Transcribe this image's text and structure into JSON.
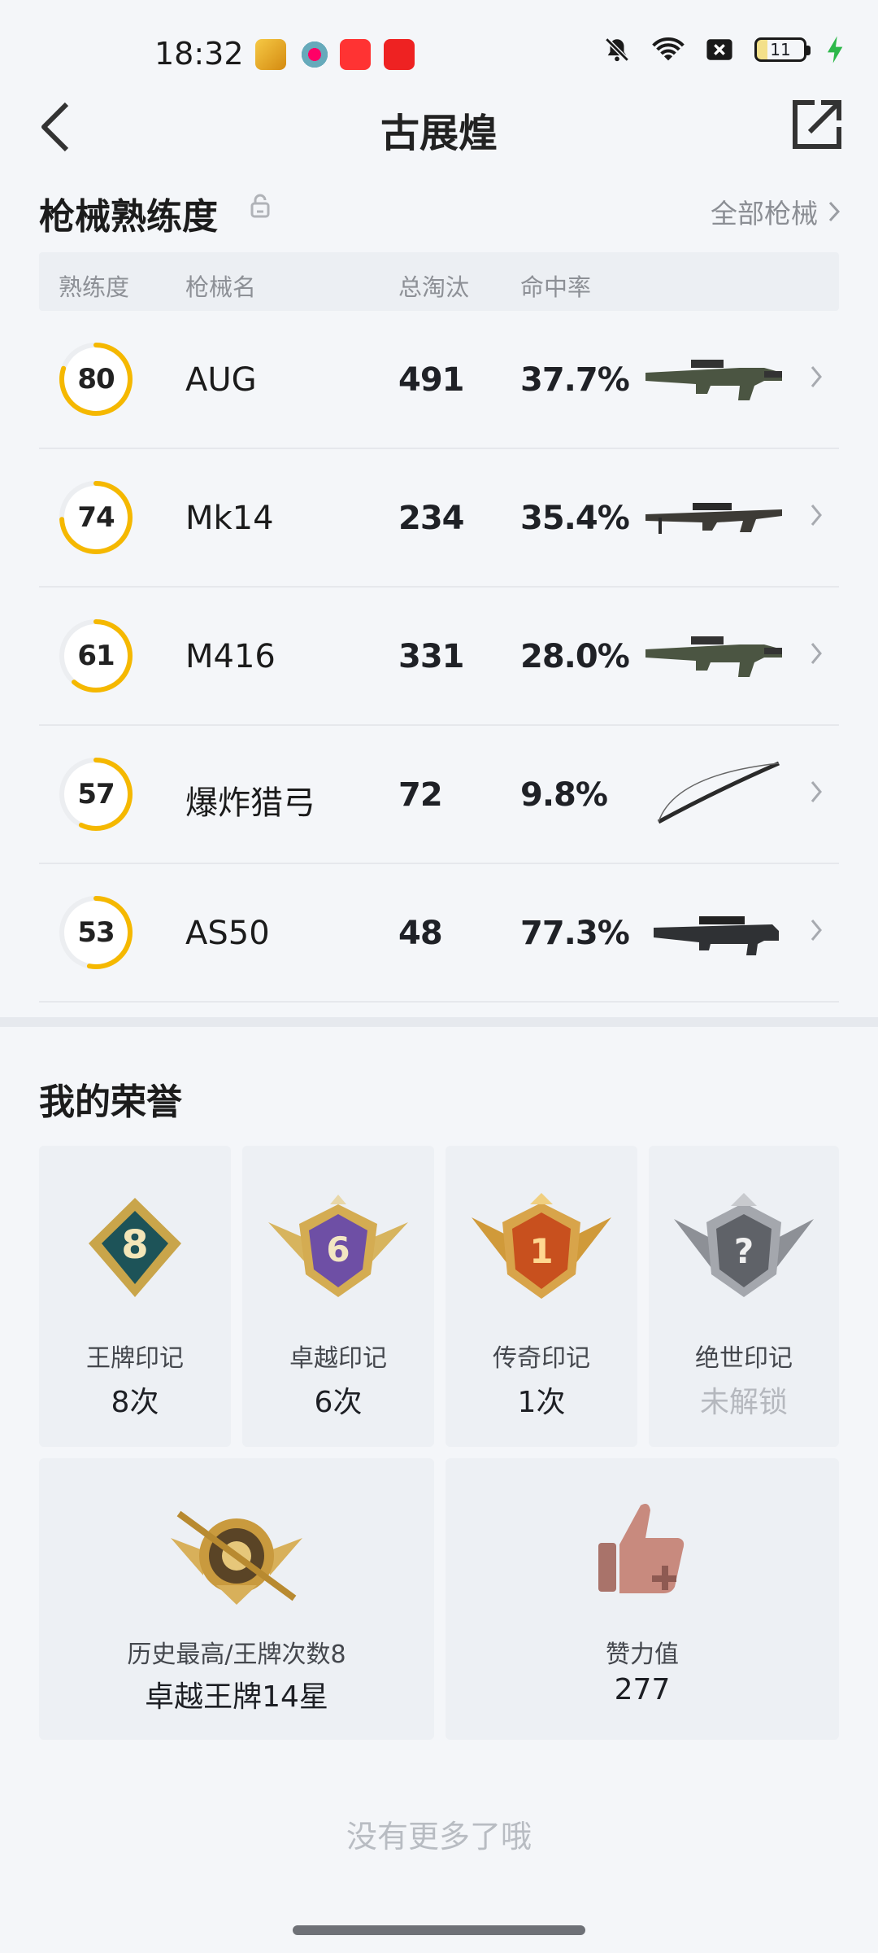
{
  "status_bar": {
    "time": "18:32",
    "battery": "11"
  },
  "header": {
    "title": "古展煌"
  },
  "weapons": {
    "title": "枪械熟练度",
    "all_link": "全部枪械",
    "columns": [
      "熟练度",
      "枪械名",
      "总淘汰",
      "命中率"
    ],
    "rows": [
      {
        "proficiency": "80",
        "proficiency_value": 80,
        "name": "AUG",
        "kills": "491",
        "accuracy": "37.7%",
        "icon": "assault-rifle-icon"
      },
      {
        "proficiency": "74",
        "proficiency_value": 74,
        "name": "Mk14",
        "kills": "234",
        "accuracy": "35.4%",
        "icon": "marksman-rifle-icon"
      },
      {
        "proficiency": "61",
        "proficiency_value": 61,
        "name": "M416",
        "kills": "331",
        "accuracy": "28.0%",
        "icon": "assault-rifle-icon"
      },
      {
        "proficiency": "57",
        "proficiency_value": 57,
        "name": "爆炸猎弓",
        "kills": "72",
        "accuracy": "9.8%",
        "icon": "bow-icon"
      },
      {
        "proficiency": "53",
        "proficiency_value": 53,
        "name": "AS50",
        "kills": "48",
        "accuracy": "77.3%",
        "icon": "sniper-rifle-icon"
      }
    ],
    "ring_color": "#f5b800"
  },
  "honors": {
    "title": "我的荣誉",
    "marks": [
      {
        "label": "王牌印记",
        "value": "8次",
        "badge_number": "8",
        "icon": "ace-mark-badge-icon"
      },
      {
        "label": "卓越印记",
        "value": "6次",
        "badge_number": "6",
        "icon": "excellent-mark-badge-icon"
      },
      {
        "label": "传奇印记",
        "value": "1次",
        "badge_number": "1",
        "icon": "legend-mark-badge-icon"
      },
      {
        "label": "绝世印记",
        "value": "未解锁",
        "badge_number": "?",
        "icon": "peerless-mark-badge-icon"
      }
    ],
    "summary": [
      {
        "label": "历史最高/王牌次数8",
        "value": "卓越王牌14星",
        "icon": "sniper-crest-badge-icon"
      },
      {
        "label": "赞力值",
        "value": "277",
        "icon": "thumbs-up-icon"
      }
    ]
  },
  "footer": {
    "no_more": "没有更多了哦"
  }
}
